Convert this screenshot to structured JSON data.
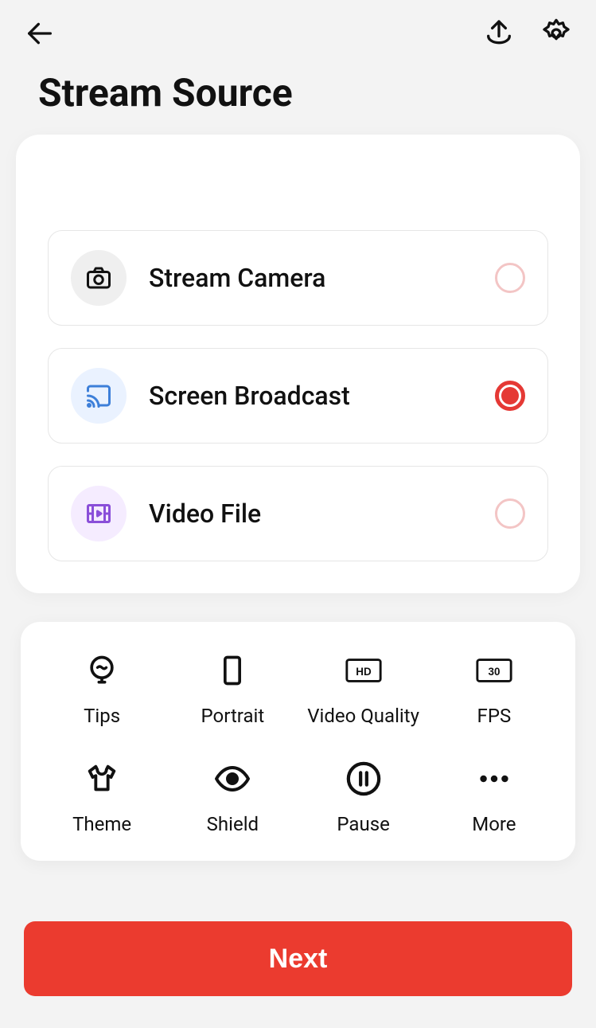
{
  "title": "Stream Source",
  "options": [
    {
      "label": "Stream Camera",
      "selected": false
    },
    {
      "label": "Screen Broadcast",
      "selected": true
    },
    {
      "label": "Video File",
      "selected": false
    }
  ],
  "grid": {
    "tips": "Tips",
    "portrait": "Portrait",
    "video_quality": "Video Quality",
    "fps": "FPS",
    "theme": "Theme",
    "shield": "Shield",
    "pause": "Pause",
    "more": "More"
  },
  "badges": {
    "hd": "HD",
    "fps": "30"
  },
  "next_label": "Next"
}
